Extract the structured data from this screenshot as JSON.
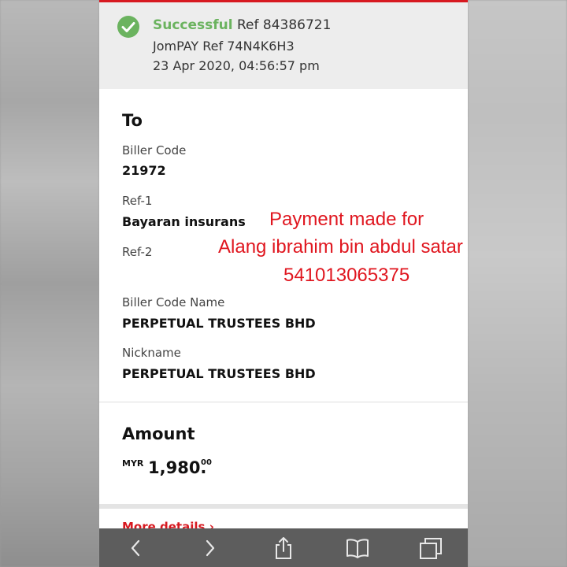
{
  "status": {
    "state": "Successful",
    "ref": "Ref 84386721",
    "jompay_ref": "JomPAY Ref 74N4K6H3",
    "datetime": "23 Apr 2020, 04:56:57 pm"
  },
  "to": {
    "heading": "To",
    "biller_code_label": "Biller Code",
    "biller_code": "21972",
    "ref1_label": "Ref-1",
    "ref1": "Bayaran insurans",
    "ref2_label": "Ref-2",
    "biller_code_name_label": "Biller Code Name",
    "biller_code_name": "PERPETUAL TRUSTEES BHD",
    "nickname_label": "Nickname",
    "nickname": "PERPETUAL TRUSTEES BHD"
  },
  "amount": {
    "heading": "Amount",
    "currency": "MYR",
    "main": "1,980.",
    "cents": "00"
  },
  "more_details": "More details",
  "annotation": {
    "line1": "Payment made for",
    "line2": "Alang ibrahim bin abdul satar",
    "line3": "541013065375"
  },
  "colors": {
    "brand_red": "#d71920",
    "success_green": "#6bb35f",
    "annotation_red": "#e0161f",
    "toolbar": "#5d5d5d"
  },
  "icons": [
    "check-circle-icon",
    "back-icon",
    "forward-icon",
    "share-icon",
    "bookmarks-icon",
    "tabs-icon",
    "chevron-right-icon"
  ]
}
